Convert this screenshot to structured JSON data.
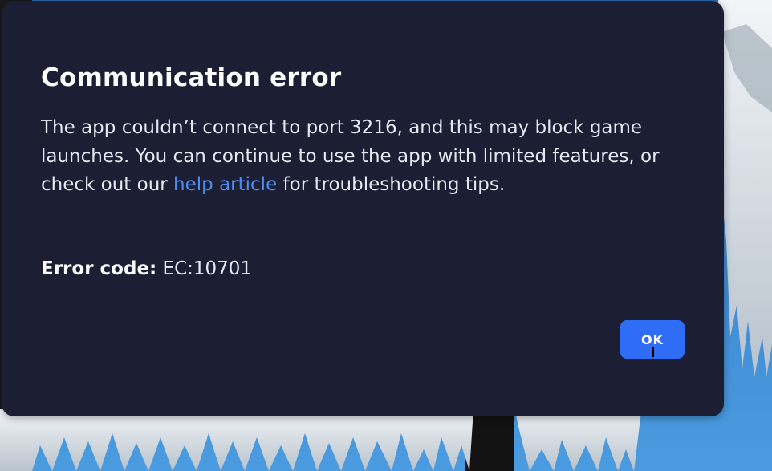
{
  "dialog": {
    "title": "Communication error",
    "body_before_link": "The app couldn’t connect to port 3216, and this may block game launches. You can continue to use the app with limited features, or check out our ",
    "link_text": "help article",
    "body_after_link": " for troubleshooting tips.",
    "error_label": "Error code:",
    "error_value": " EC:10701",
    "ok_label": "OK"
  },
  "colors": {
    "dialog_background": "#1c1f33",
    "link": "#4d8cf0",
    "ok_button": "#2f6df6"
  }
}
